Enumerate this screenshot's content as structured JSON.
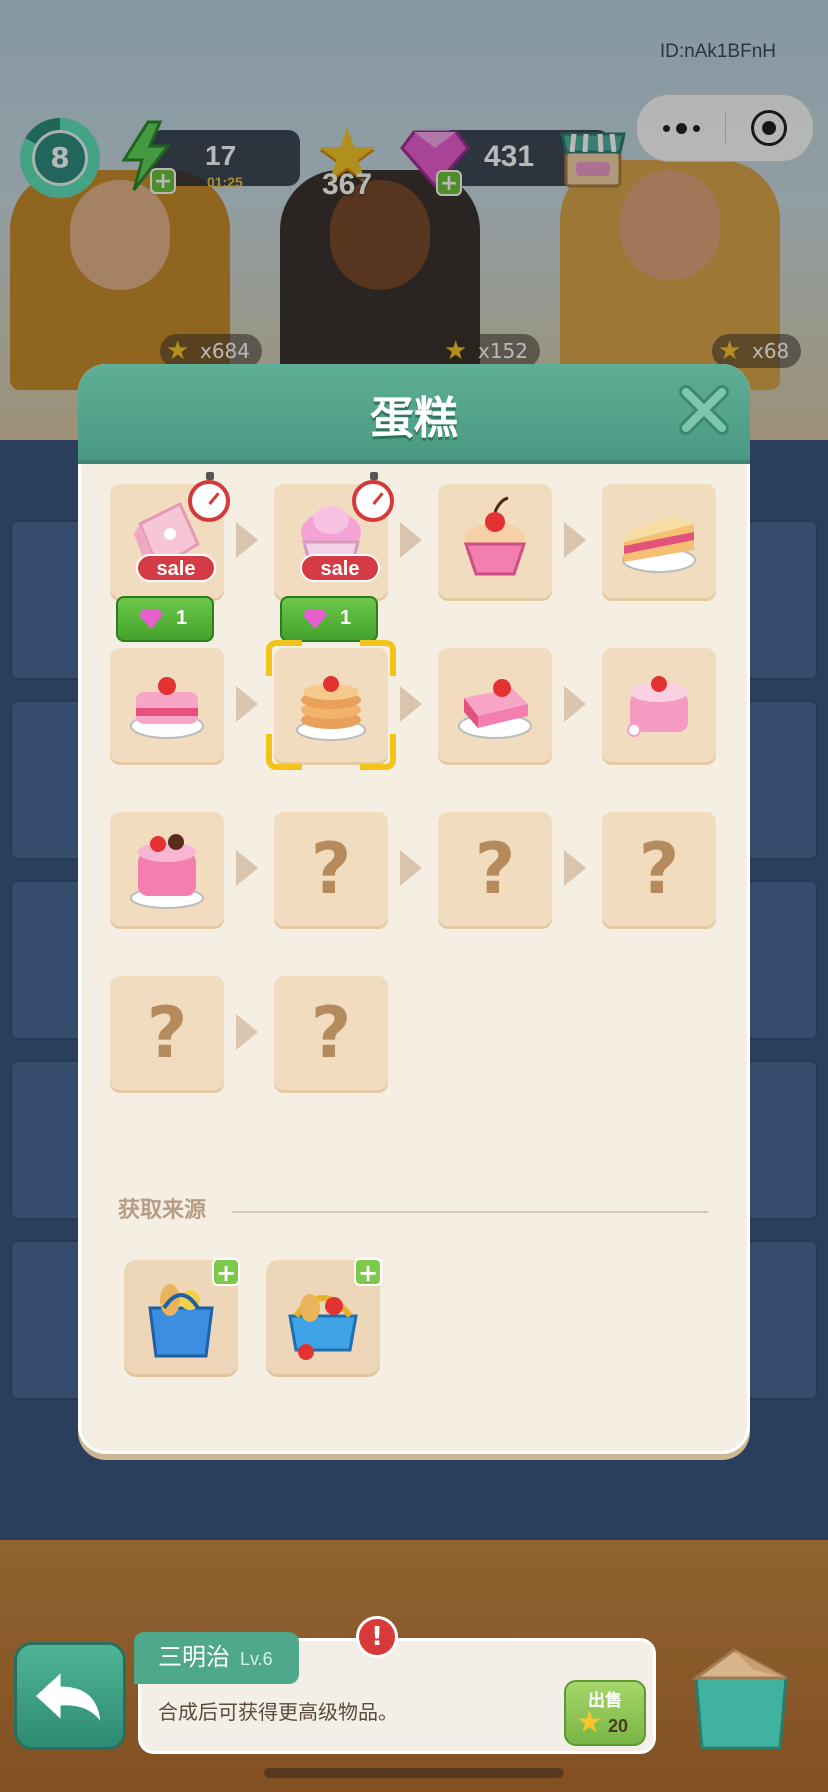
{
  "system": {
    "id_label": "ID:nAk1BFnH"
  },
  "hud": {
    "level": "8",
    "energy": "17",
    "energy_timer": "01:25",
    "stars": "367",
    "gems": "431"
  },
  "customers": [
    {
      "count": "x684"
    },
    {
      "count": "x152"
    },
    {
      "count": "x68"
    }
  ],
  "modal": {
    "title": "蛋糕",
    "chain": [
      {
        "state": "unlocked",
        "item": "cake-slice-box",
        "timer": true,
        "tag": "sale",
        "gem_cost": "1"
      },
      {
        "state": "unlocked",
        "item": "cupcake-frosting",
        "timer": true,
        "tag": "sale",
        "gem_cost": "1"
      },
      {
        "state": "unlocked",
        "item": "cherry-cupcake"
      },
      {
        "state": "unlocked",
        "item": "cake-slice"
      },
      {
        "state": "unlocked",
        "item": "cherry-cake-slice"
      },
      {
        "state": "unlocked",
        "item": "pancake-stack",
        "selected": true
      },
      {
        "state": "unlocked",
        "item": "strawberry-cake-slice"
      },
      {
        "state": "unlocked",
        "item": "strawberry-round-cake"
      },
      {
        "state": "unlocked",
        "item": "decorated-layer-cake"
      },
      {
        "state": "locked",
        "label": "?"
      },
      {
        "state": "locked",
        "label": "?"
      },
      {
        "state": "locked",
        "label": "?"
      },
      {
        "state": "locked",
        "label": "?"
      },
      {
        "state": "locked",
        "label": "?"
      }
    ],
    "source_label": "获取来源",
    "sources": [
      {
        "item": "grocery-bag-source"
      },
      {
        "item": "food-basket-source"
      }
    ]
  },
  "bottom": {
    "item_name": "三明治",
    "item_level": "Lv.6",
    "hint": "合成后可获得更高级物品。",
    "alert": "!",
    "sell_label": "出售",
    "sell_value": "20"
  },
  "colors": {
    "header": "#4a9a83",
    "modal_bg": "#f5efe3",
    "cell_bg": "#f2dcbf",
    "select": "#f2c31a",
    "gem_button": "#45a22e"
  }
}
